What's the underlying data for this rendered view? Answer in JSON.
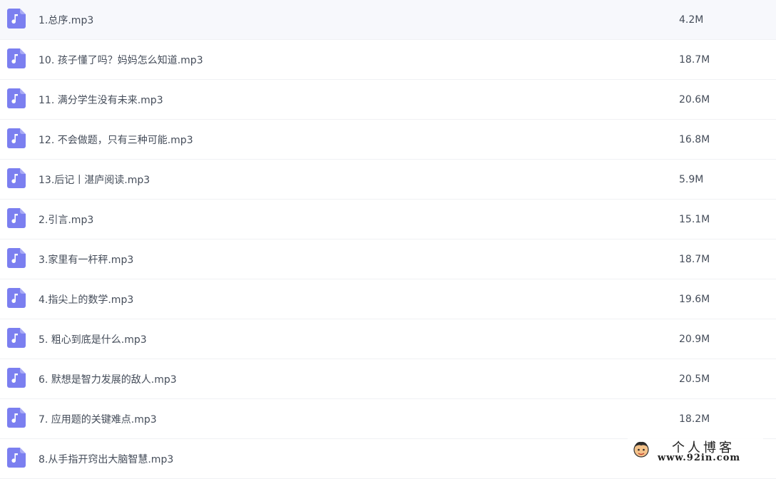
{
  "files": [
    {
      "name": "1.总序.mp3",
      "size": "4.2M"
    },
    {
      "name": "10. 孩子懂了吗？妈妈怎么知道.mp3",
      "size": "18.7M"
    },
    {
      "name": "11. 满分学生没有未来.mp3",
      "size": "20.6M"
    },
    {
      "name": "12. 不会做题，只有三种可能.mp3",
      "size": "16.8M"
    },
    {
      "name": "13.后记丨湛庐阅读.mp3",
      "size": "5.9M"
    },
    {
      "name": "2.引言.mp3",
      "size": "15.1M"
    },
    {
      "name": "3.家里有一杆秤.mp3",
      "size": "18.7M"
    },
    {
      "name": "4.指尖上的数学.mp3",
      "size": "19.6M"
    },
    {
      "name": "5. 粗心到底是什么.mp3",
      "size": "20.9M"
    },
    {
      "name": "6. 默想是智力发展的敌人.mp3",
      "size": "20.5M"
    },
    {
      "name": "7. 应用题的关键难点.mp3",
      "size": "18.2M"
    },
    {
      "name": "8.从手指开窍出大脑智慧.mp3",
      "size": ""
    }
  ],
  "icon": {
    "name": "music-file-icon",
    "color": "#7b7ff0"
  },
  "watermark": {
    "title": "个人博客",
    "url": "www.92in.com"
  }
}
